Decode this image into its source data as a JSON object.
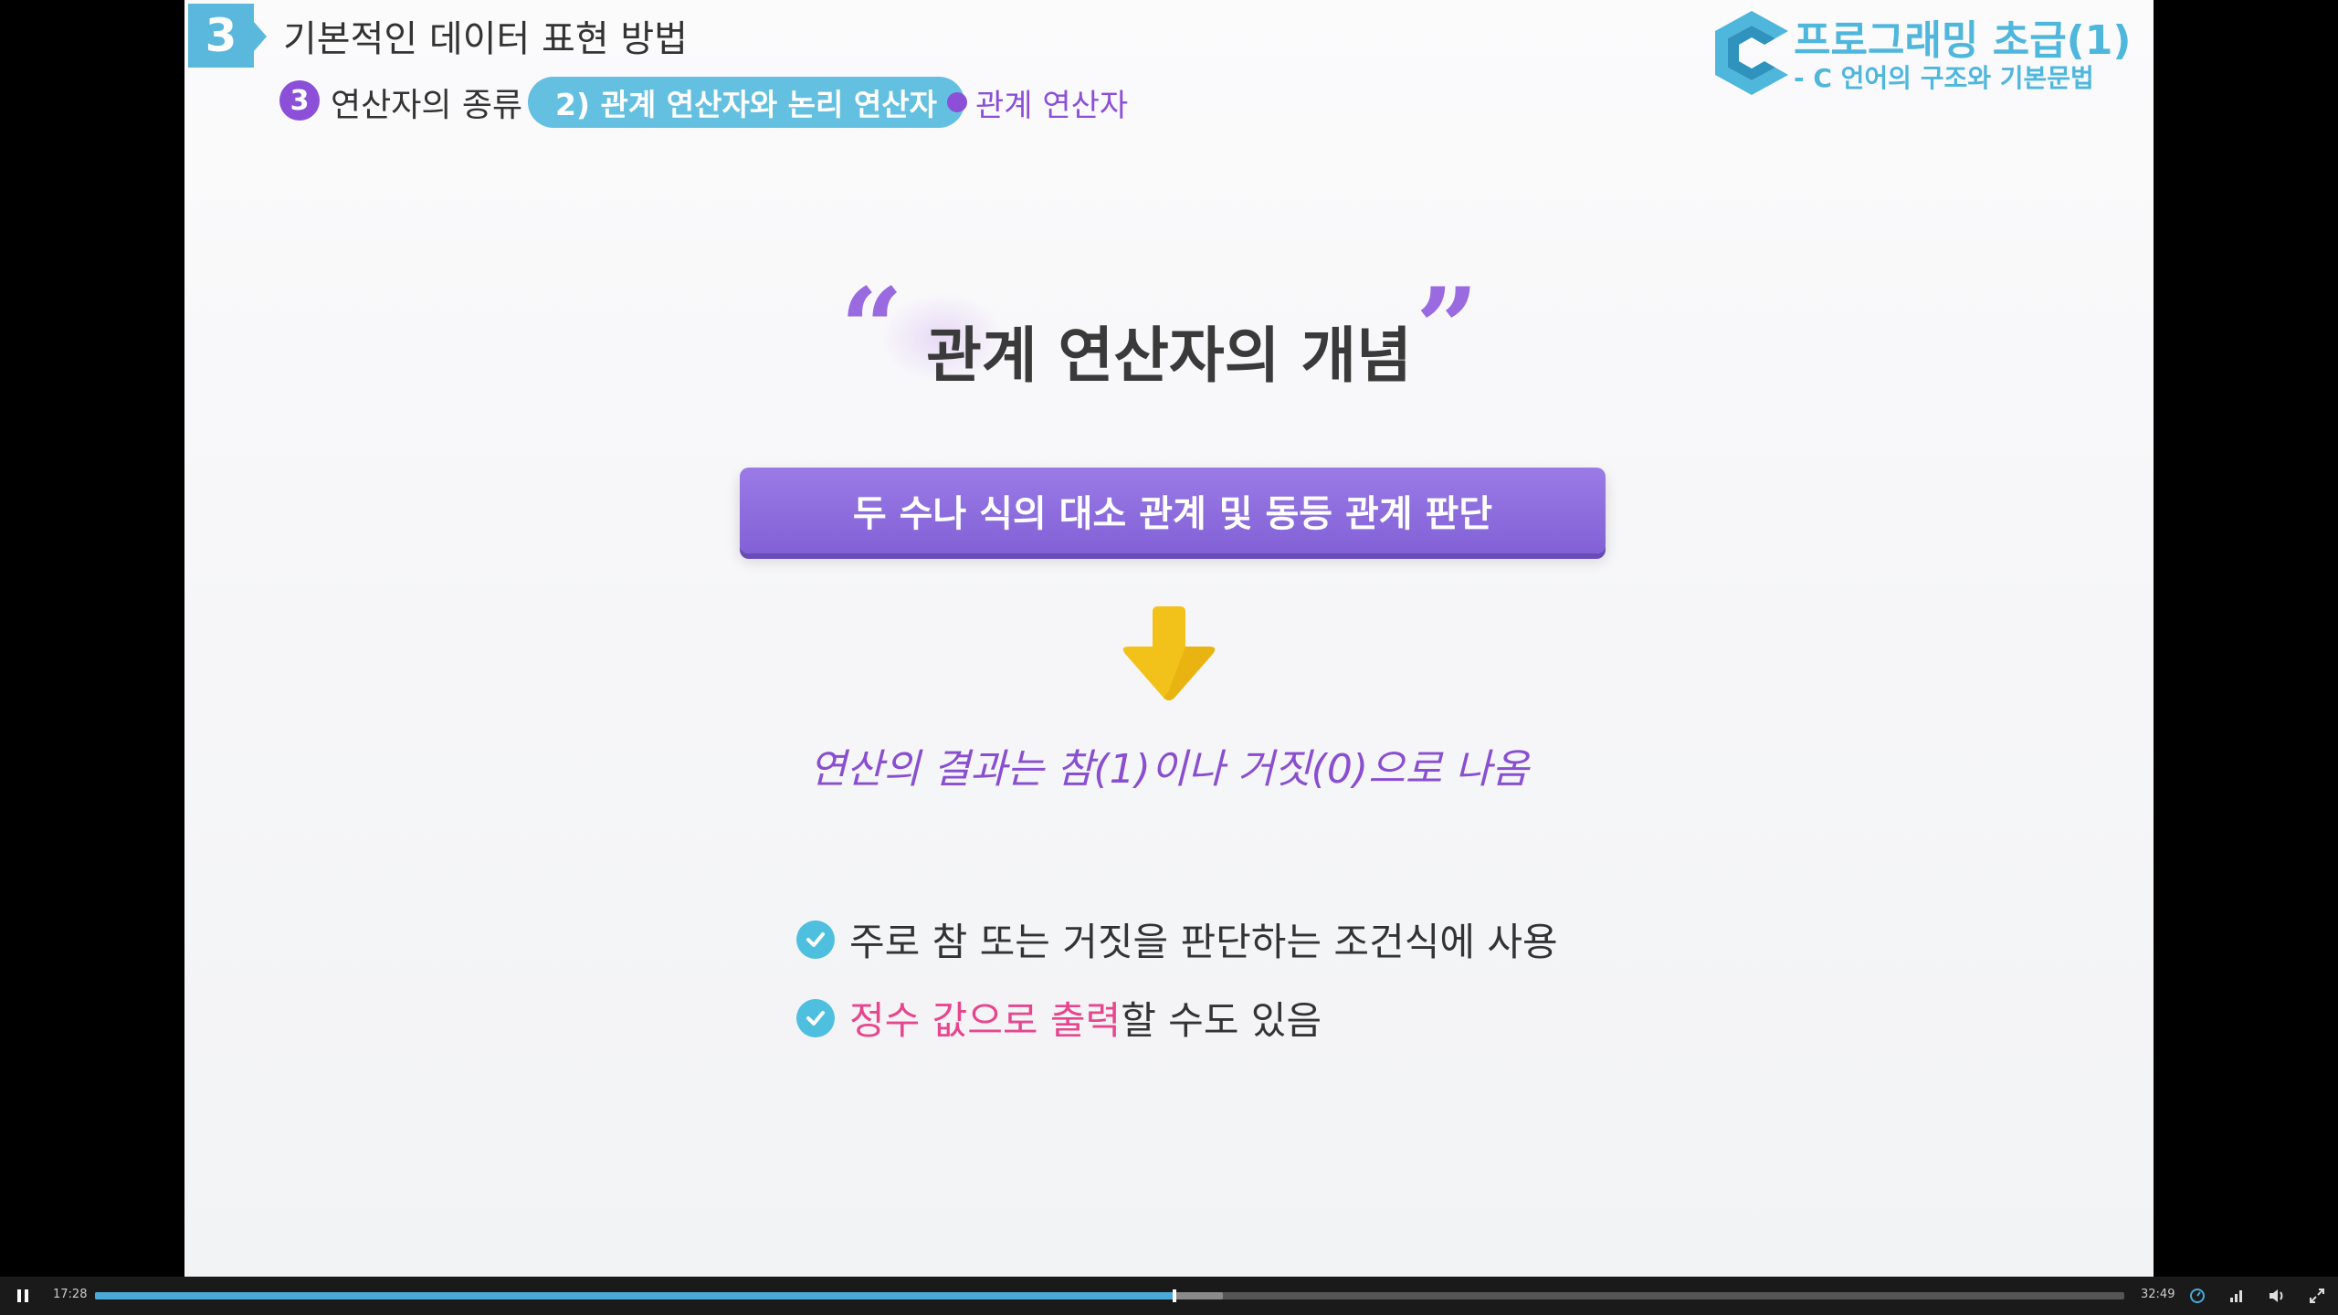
{
  "header": {
    "section_number": "3",
    "section_title": "기본적인 데이터 표현 방법",
    "breadcrumb": {
      "number": "3",
      "level1": "연산자의 종류",
      "level2": "2) 관계 연산자와 논리 연산자",
      "level3": "관계 연산자"
    },
    "course_title": "프로그래밍 초급(1)",
    "course_subtitle": "- C 언어의 구조와 기본문법"
  },
  "content": {
    "title": "관계 연산자의 개념",
    "definition": "두 수나 식의 대소 관계 및 동등 관계 판단",
    "result": "연산의 결과는 참(1)이나 거짓(0)으로 나옴",
    "bullets": [
      {
        "text": "주로 참 또는 거짓을 판단하는 조건식에 사용"
      },
      {
        "highlight": "정수 값으로 출력",
        "rest": "할 수도 있음"
      }
    ]
  },
  "player": {
    "current_time": "17:28",
    "total_time": "32:49",
    "progress_fraction": 0.532,
    "buffered_fraction": 0.556,
    "icons": [
      "pause-icon",
      "speed-icon",
      "quality-icon",
      "volume-icon",
      "fullscreen-icon"
    ]
  },
  "colors": {
    "accent_blue": "#5ab8dd",
    "accent_purple": "#8b4fd8",
    "highlight_pink": "#e8458f",
    "progress": "#4aa9d8"
  }
}
